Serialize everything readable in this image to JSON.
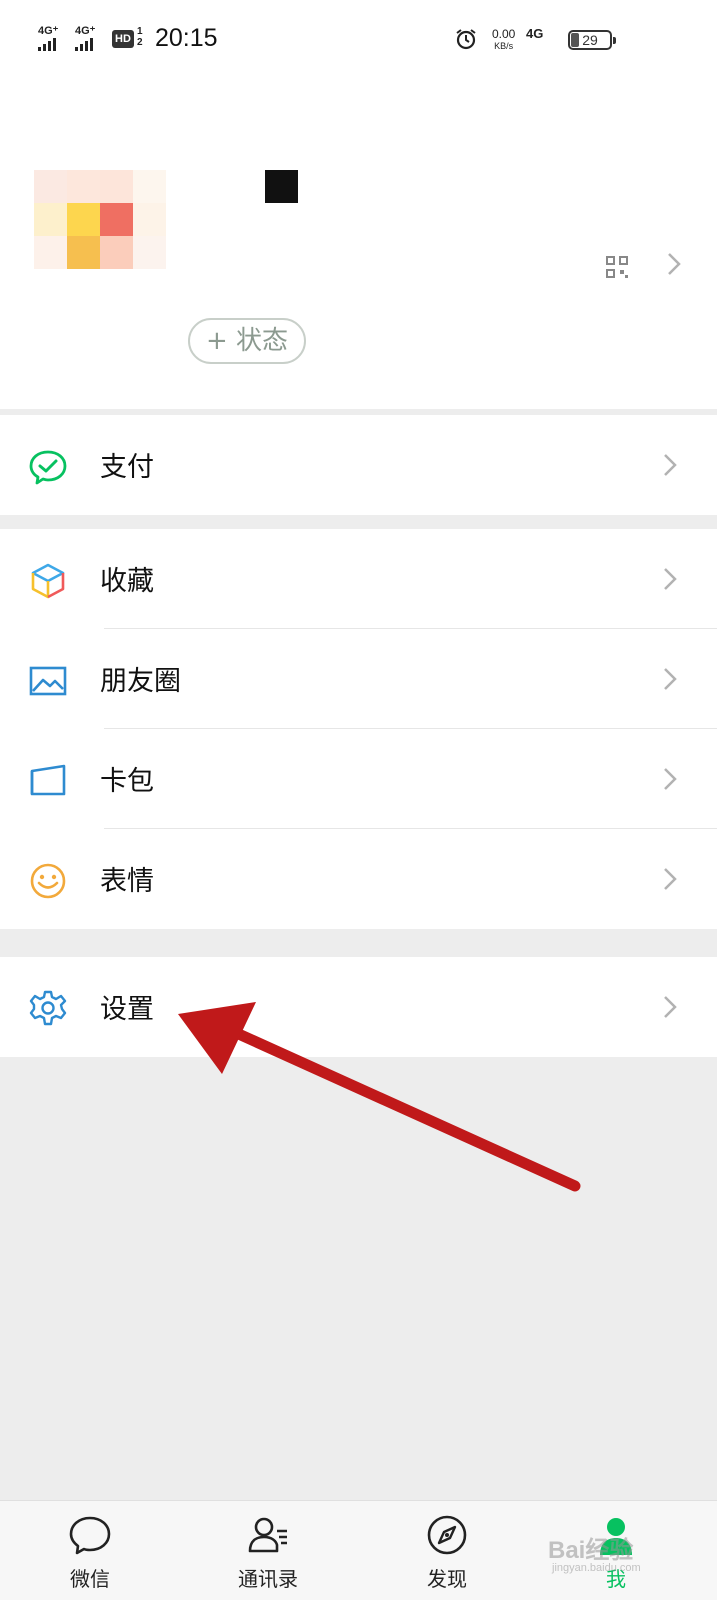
{
  "status_bar": {
    "sim1": "4G⁺",
    "sim2": "4G⁺",
    "hd": "HD",
    "hd_sub_top": "1",
    "hd_sub_bottom": "2",
    "time": "20:15",
    "speed_value": "0.00",
    "speed_unit": "KB/s",
    "network": "4G",
    "battery": "29"
  },
  "profile": {
    "status_button": "+ 状态"
  },
  "menu": {
    "pay": "支付",
    "favorites": "收藏",
    "moments": "朋友圈",
    "cards": "卡包",
    "stickers": "表情",
    "settings": "设置"
  },
  "tabs": [
    {
      "label": "微信",
      "icon": "chat-icon"
    },
    {
      "label": "通讯录",
      "icon": "contacts-icon"
    },
    {
      "label": "发现",
      "icon": "compass-icon"
    },
    {
      "label": "我",
      "icon": "me-icon"
    }
  ],
  "watermark": {
    "text": "Bai经验",
    "sub": "jingyan.baidu.com"
  },
  "colors": {
    "accent_green": "#07c160",
    "annotation_arrow": "#c0191a",
    "page_background": "#ededed"
  }
}
